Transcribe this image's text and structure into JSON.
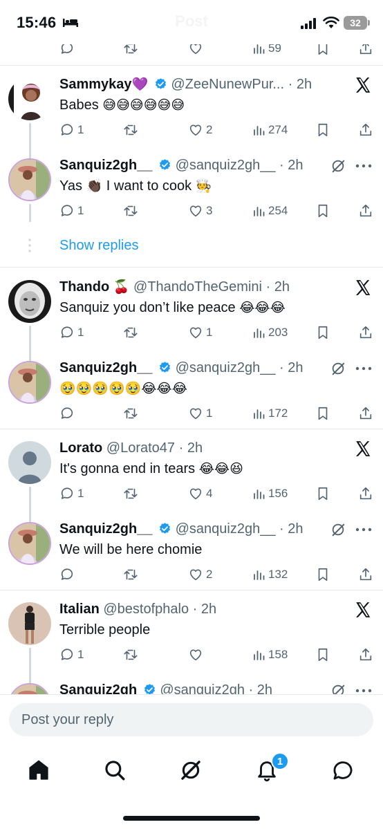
{
  "status_bar": {
    "time": "15:46",
    "ghost_title": "Post",
    "battery": "32"
  },
  "top_actions": {
    "views": "59"
  },
  "tweets": [
    {
      "name": "Sammykay",
      "name_suffix": "💜",
      "verified": true,
      "handle": "@ZeeNunewPur...",
      "time": "· 2h",
      "text": "Babes",
      "emojis": "😅😅😅😅😅😅",
      "corner": "x-logo",
      "replies": "1",
      "reposts": "",
      "likes": "2",
      "views": "274"
    },
    {
      "name": "Sanquiz2gh__",
      "name_suffix": "",
      "verified": true,
      "handle": "@sanquiz2gh__",
      "time": "· 2h",
      "text": "Yas",
      "emojis": "👏🏿",
      "text2": "I want to cook",
      "emojis2": "🧑‍🍳",
      "corner": "grok",
      "replies": "1",
      "reposts": "",
      "likes": "3",
      "views": "254"
    },
    {
      "name": "Thando",
      "name_suffix": "🍒",
      "verified": false,
      "handle": "@ThandoTheGemini",
      "time": "· 2h",
      "text": "Sanquiz you don’t like peace",
      "emojis": "😂😂😂",
      "corner": "x-logo",
      "replies": "1",
      "reposts": "",
      "likes": "1",
      "views": "203"
    },
    {
      "name": "Sanquiz2gh__",
      "name_suffix": "",
      "verified": true,
      "handle": "@sanquiz2gh__",
      "time": "· 2h",
      "text": "",
      "emojis": "🥹🥹🥹🥹🥹😂😂😂",
      "corner": "grok",
      "replies": "",
      "reposts": "",
      "likes": "1",
      "views": "172"
    },
    {
      "name": "Lorato",
      "name_suffix": "",
      "verified": false,
      "handle": "@Lorato47",
      "time": "· 2h",
      "text": "It's gonna end in tears",
      "emojis": "😂😂😆",
      "corner": "x-logo",
      "replies": "1",
      "reposts": "",
      "likes": "4",
      "views": "156"
    },
    {
      "name": "Sanquiz2gh__",
      "name_suffix": "",
      "verified": true,
      "handle": "@sanquiz2gh__",
      "time": "· 2h",
      "text": "We will be here chomie",
      "emojis": "",
      "corner": "grok",
      "replies": "",
      "reposts": "",
      "likes": "2",
      "views": "132"
    },
    {
      "name": "Italian",
      "name_suffix": "",
      "verified": false,
      "handle": "@bestofphalo",
      "time": "· 2h",
      "text": "Terrible people",
      "emojis": "",
      "corner": "x-logo",
      "replies": "1",
      "reposts": "",
      "likes": "",
      "views": "158"
    },
    {
      "name": "Sanquiz2gh",
      "name_suffix": "",
      "verified": true,
      "handle": "@sanquiz2gh",
      "time": "· 2h",
      "corner": "grok"
    }
  ],
  "show_replies": "Show replies",
  "reply_bar": {
    "placeholder": "Post your reply"
  },
  "tabbar": {
    "notifications_badge": "1"
  },
  "colors": {
    "accent": "#1d9bf0",
    "text": "#0f1419",
    "muted": "#536471",
    "divider": "#e6e9ec",
    "heart": "#9b59d6"
  }
}
